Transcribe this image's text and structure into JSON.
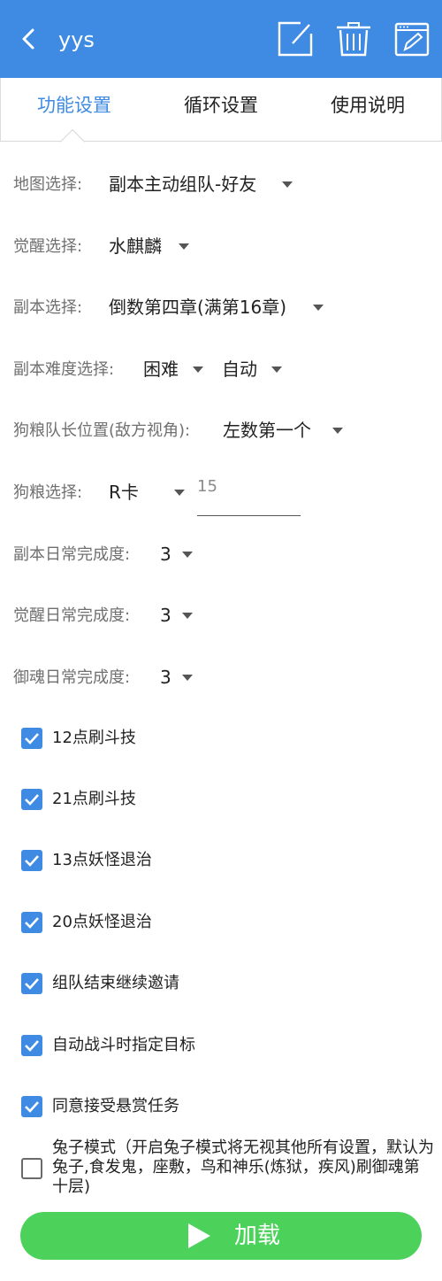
{
  "header": {
    "title": "yys"
  },
  "tabs": [
    {
      "label": "功能设置",
      "active": true
    },
    {
      "label": "循环设置",
      "active": false
    },
    {
      "label": "使用说明",
      "active": false
    }
  ],
  "settings": {
    "map_label": "地图选择:",
    "map_value": "副本主动组队-好友",
    "awaken_label": "觉醒选择:",
    "awaken_value": "水麒麟",
    "dungeon_label": "副本选择:",
    "dungeon_value": "倒数第四章(满第16章)",
    "difficulty_label": "副本难度选择:",
    "difficulty_value": "困难",
    "mode_value": "自动",
    "leader_label": "狗粮队长位置(敌方视角):",
    "leader_value": "左数第一个",
    "fodder_label": "狗粮选择:",
    "fodder_value": "R卡",
    "fodder_input_value": "15",
    "dungeon_daily_label": "副本日常完成度:",
    "dungeon_daily_value": "3",
    "awaken_daily_label": "觉醒日常完成度:",
    "awaken_daily_value": "3",
    "soul_daily_label": "御魂日常完成度:",
    "soul_daily_value": "3"
  },
  "checkboxes": [
    {
      "label": "12点刷斗技",
      "checked": true
    },
    {
      "label": "21点刷斗技",
      "checked": true
    },
    {
      "label": "13点妖怪退治",
      "checked": true
    },
    {
      "label": "20点妖怪退治",
      "checked": true
    },
    {
      "label": "组队结束继续邀请",
      "checked": true
    },
    {
      "label": "自动战斗时指定目标",
      "checked": true
    },
    {
      "label": "同意接受悬赏任务",
      "checked": true
    }
  ],
  "rabbit_mode": {
    "label": "兔子模式（开启兔子模式将无视其他所有设置，默认为兔子,食发鬼，座敷，鸟和神乐(炼狱，疾风)刷御魂第十层)",
    "checked": false
  },
  "load_button": {
    "label": "加载"
  },
  "colors": {
    "primary": "#3f8be3",
    "load": "#4cd25a"
  }
}
